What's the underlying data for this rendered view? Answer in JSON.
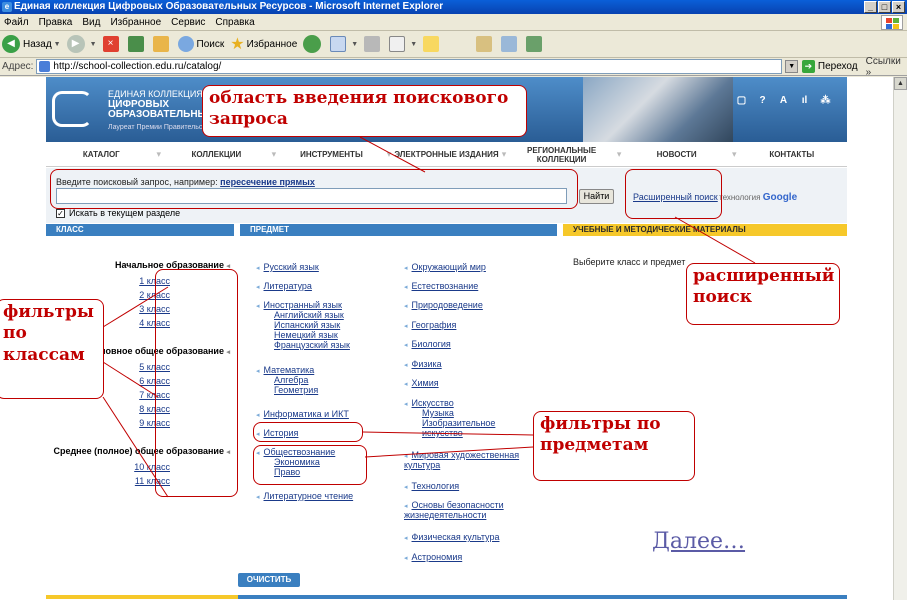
{
  "window": {
    "title": "Единая коллекция Цифровых Образовательных Ресурсов - Microsoft Internet Explorer"
  },
  "menu": [
    "Файл",
    "Правка",
    "Вид",
    "Избранное",
    "Сервис",
    "Справка"
  ],
  "toolbar": {
    "back": "Назад",
    "search": "Поиск",
    "favorites": "Избранное"
  },
  "address": {
    "label": "Адрес:",
    "url": "http://school-collection.edu.ru/catalog/",
    "go": "Переход",
    "links": "Ссылки"
  },
  "site": {
    "logo_line1": "ЕДИНАЯ КОЛЛЕКЦИЯ",
    "logo_line2": "ЦИФРОВЫХ ОБРАЗОВАТЕЛЬНЫХ Р",
    "laureate": "Лауреат Премии Правительст",
    "icons": [
      "▢",
      "?",
      "A",
      "ıl",
      "⁂"
    ]
  },
  "nav": [
    "КАТАЛОГ",
    "КОЛЛЕКЦИИ",
    "ИНСТРУМЕНТЫ",
    "ЭЛЕКТРОННЫЕ ИЗДАНИЯ",
    "РЕГИОНАЛЬНЫЕ КОЛЛЕКЦИИ",
    "НОВОСТИ",
    "КОНТАКТЫ"
  ],
  "search": {
    "hint": "Введите поисковый запрос, например:",
    "example": "пересечение прямых",
    "find": "Найти",
    "advanced": "Расширенный поиск",
    "technology": "технология",
    "google": "Google",
    "in_section": "Искать в текущем разделе"
  },
  "columns": {
    "class": "КЛАСС",
    "subject": "ПРЕДМЕТ",
    "materials": "УЧЕБНЫЕ И МЕТОДИЧЕСКИЕ МАТЕРИАЛЫ"
  },
  "grades": [
    {
      "title": "Начальное образование",
      "items": [
        "1 класс",
        "2 класс",
        "3 класс",
        "4 класс"
      ]
    },
    {
      "title": "Основное общее образование",
      "items": [
        "5 класс",
        "6 класс",
        "7 класс",
        "8 класс",
        "9 класс"
      ]
    },
    {
      "title": "Среднее (полное) общее образование",
      "items": [
        "10 класс",
        "11 класс"
      ]
    }
  ],
  "subjects_left": [
    {
      "name": "Русский язык",
      "subs": []
    },
    {
      "name": "Литература",
      "subs": []
    },
    {
      "name": "Иностранный язык",
      "subs": [
        "Английский язык",
        "Испанский язык",
        "Немецкий язык",
        "Французский язык"
      ]
    },
    {
      "name": "Математика",
      "subs": [
        "Алгебра",
        "Геометрия"
      ]
    },
    {
      "name": "Информатика и ИКТ",
      "subs": []
    },
    {
      "name": "История",
      "subs": []
    },
    {
      "name": "Обществознание",
      "subs": [
        "Экономика",
        "Право"
      ]
    },
    {
      "name": "Литературное чтение",
      "subs": []
    }
  ],
  "subjects_right": [
    {
      "name": "Окружающий мир",
      "subs": []
    },
    {
      "name": "Естествознание",
      "subs": []
    },
    {
      "name": "Природоведение",
      "subs": []
    },
    {
      "name": "География",
      "subs": []
    },
    {
      "name": "Биология",
      "subs": []
    },
    {
      "name": "Физика",
      "subs": []
    },
    {
      "name": "Химия",
      "subs": []
    },
    {
      "name": "Искусство",
      "subs": [
        "Музыка",
        "Изобразительное искусство"
      ]
    },
    {
      "name": "Мировая художественная культура",
      "subs": []
    },
    {
      "name": "Технология",
      "subs": []
    },
    {
      "name": "Основы безопасности жизнедеятельности",
      "subs": []
    },
    {
      "name": "Физическая культура",
      "subs": []
    },
    {
      "name": "Астрономия",
      "subs": []
    }
  ],
  "materials_text": "Выберите класс и предмет",
  "clear": "ОЧИСТИТЬ",
  "annotations": {
    "search_area": "область введения поискового запроса",
    "advanced_search": "расширенный поиск",
    "grade_filters": "фильтры по классам",
    "subject_filters": "фильтры по предметам",
    "next": "Далее…"
  },
  "colors": {
    "annotation": "#c00000",
    "header_blue": "#3a7fc0",
    "header_yellow": "#f6c82a",
    "link": "#1a3a8a"
  }
}
